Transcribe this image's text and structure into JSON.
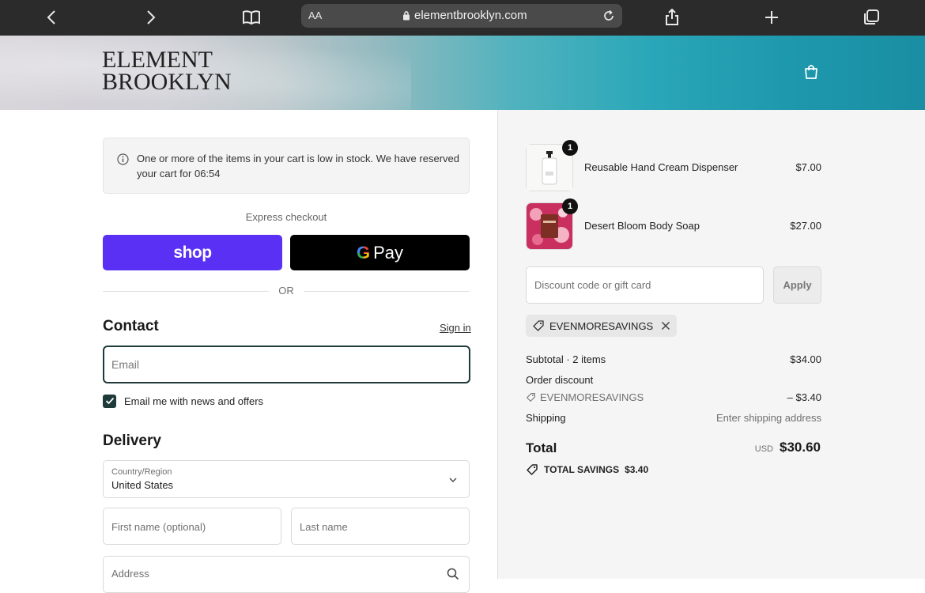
{
  "browser": {
    "text_size_label": "AA",
    "url": "elementbrooklyn.com"
  },
  "brand": {
    "line1": "ELEMENT",
    "line2": "BROOKLYN"
  },
  "notice": {
    "text": "One or more of the items in your cart is low in stock. We have reserved your cart for 06:54"
  },
  "express": {
    "label": "Express checkout",
    "shop_label": "shop",
    "gpay_label": "Pay",
    "or_label": "OR"
  },
  "contact": {
    "heading": "Contact",
    "signin_label": "Sign in",
    "email_placeholder": "Email",
    "news_label": "Email me with news and offers",
    "news_checked": true
  },
  "delivery": {
    "heading": "Delivery",
    "country_label": "Country/Region",
    "country_value": "United States",
    "first_name_placeholder": "First name (optional)",
    "last_name_placeholder": "Last name",
    "address_placeholder": "Address"
  },
  "cart": {
    "items": [
      {
        "name": "Reusable Hand Cream Dispenser",
        "price": "$7.00",
        "qty": "1"
      },
      {
        "name": "Desert Bloom Body Soap",
        "price": "$27.00",
        "qty": "1"
      }
    ],
    "discount_placeholder": "Discount code or gift card",
    "apply_label": "Apply",
    "applied_code": "EVENMORESAVINGS",
    "subtotal_label": "Subtotal · 2 items",
    "subtotal_value": "$34.00",
    "order_discount_label": "Order discount",
    "order_discount_code": "EVENMORESAVINGS",
    "order_discount_value": "– $3.40",
    "shipping_label": "Shipping",
    "shipping_value": "Enter shipping address",
    "total_label": "Total",
    "total_currency": "USD",
    "total_value": "$30.60",
    "savings_label": "TOTAL SAVINGS",
    "savings_value": "$3.40"
  },
  "colors": {
    "shop_purple": "#5a31f4",
    "field_focus": "#1f3a3a",
    "toolbar": "#2b2b2b"
  }
}
